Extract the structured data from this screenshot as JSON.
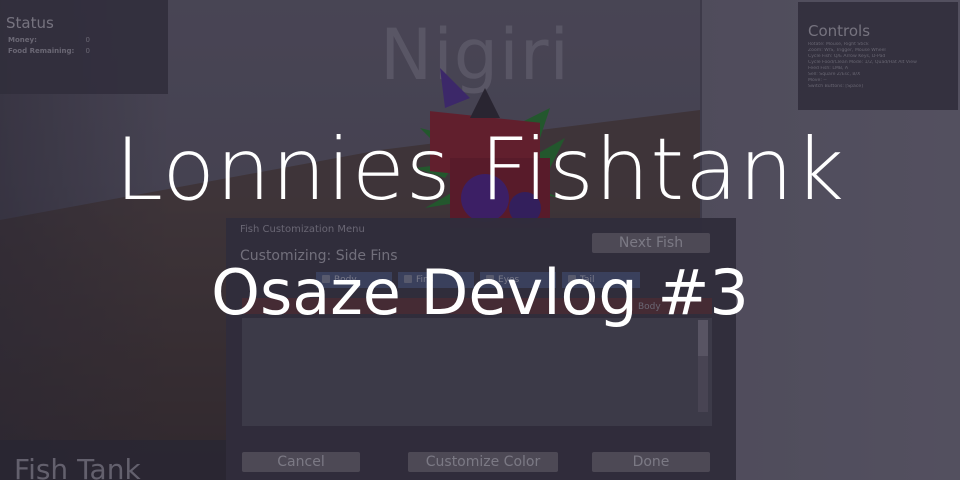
{
  "thumbnail": {
    "title": "Lonnies Fishtank",
    "subtitle": "Osaze Devlog #3"
  },
  "scene": {
    "sign_text": "Nigiri"
  },
  "status_panel": {
    "title": "Status",
    "rows": [
      {
        "label": "Money:",
        "value": "0"
      },
      {
        "label": "Food Remaining:",
        "value": "0"
      }
    ]
  },
  "controls_panel": {
    "title": "Controls",
    "items": [
      "Rotate: Mouse, Right Stick",
      "Zoom: W/S, Trigger, Mouse Wheel",
      "Cycle Fish: Q/E Arrow Keys, D-Pad",
      "Cycle Food/Clean Mode: 1/2, Quad/Hat Alt View",
      "Feed Fish: LMB, A",
      "Sell: Square Z/Esc, B/X",
      "Move: --",
      "Switch Buttons: [Space]"
    ]
  },
  "fish_tank_panel": {
    "label": "Fish Tank"
  },
  "menu": {
    "title": "Fish Customization Menu",
    "customizing_label": "Customizing: Side Fins",
    "next_fish_label": "Next Fish",
    "tabs": [
      {
        "label": "Body"
      },
      {
        "label": "Fins"
      },
      {
        "label": "Eyes"
      },
      {
        "label": "Tail"
      }
    ],
    "part_label": "Body",
    "cancel_label": "Cancel",
    "customize_color_label": "Customize Color",
    "done_label": "Done"
  },
  "colors": {
    "overlay": "#140f1c",
    "title_text": "#ffffff",
    "tab_blue": "#56628a",
    "fish_red": "#9a2a3a",
    "fish_purple": "#5a2a9a",
    "fin_green": "#2f8a3a"
  }
}
